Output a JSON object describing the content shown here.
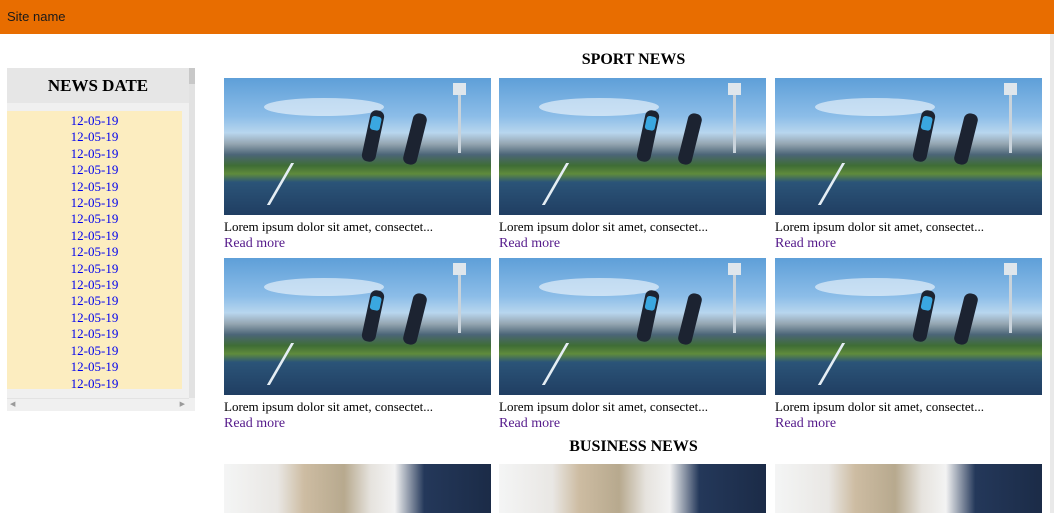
{
  "header": {
    "site_name": "Site name"
  },
  "sidebar": {
    "title": "NEWS DATE",
    "dates": [
      "12-05-19",
      "12-05-19",
      "12-05-19",
      "12-05-19",
      "12-05-19",
      "12-05-19",
      "12-05-19",
      "12-05-19",
      "12-05-19",
      "12-05-19",
      "12-05-19",
      "12-05-19",
      "12-05-19",
      "12-05-19",
      "12-05-19",
      "12-05-19",
      "12-05-19"
    ]
  },
  "sport": {
    "title": "SPORT NEWS",
    "cards": [
      {
        "caption": "Lorem ipsum dolor sit amet, consectet...",
        "link": "Read more"
      },
      {
        "caption": "Lorem ipsum dolor sit amet, consectet...",
        "link": "Read more"
      },
      {
        "caption": "Lorem ipsum dolor sit amet, consectet...",
        "link": "Read more"
      },
      {
        "caption": "Lorem ipsum dolor sit amet, consectet...",
        "link": "Read more"
      },
      {
        "caption": "Lorem ipsum dolor sit amet, consectet...",
        "link": "Read more"
      },
      {
        "caption": "Lorem ipsum dolor sit amet, consectet...",
        "link": "Read more"
      }
    ]
  },
  "business": {
    "title": "BUSINESS NEWS"
  }
}
